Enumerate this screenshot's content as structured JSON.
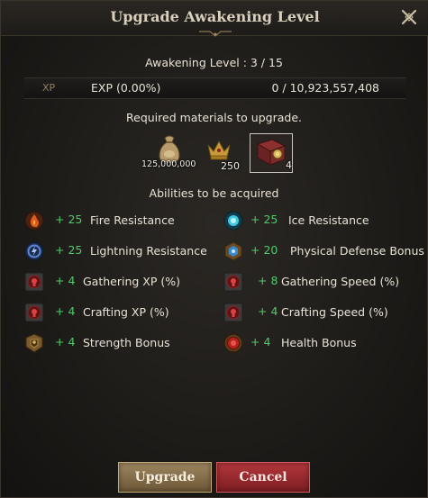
{
  "dialog": {
    "title": "Upgrade Awakening Level",
    "awakening_level_text": "Awakening Level : 3 / 15"
  },
  "xp": {
    "tag": "XP",
    "exp_text": "EXP (0.00%)",
    "value_text": "0 / 10,923,557,408"
  },
  "materials": {
    "label": "Required materials to upgrade.",
    "items": [
      {
        "icon": "silver-bag-icon",
        "quantity": "125,000,000"
      },
      {
        "icon": "crown-icon",
        "quantity": "250"
      },
      {
        "icon": "awakening-book-icon",
        "quantity": "4"
      }
    ]
  },
  "abilities": {
    "label": "Abilities to be acquired",
    "items": [
      {
        "icon": "fire-resistance-icon",
        "value": "+ 25",
        "name": "Fire Resistance"
      },
      {
        "icon": "ice-resistance-icon",
        "value": "+ 25",
        "name": "Ice Resistance"
      },
      {
        "icon": "lightning-resistance-icon",
        "value": "+ 25",
        "name": "Lightning Resistance"
      },
      {
        "icon": "physical-defense-icon",
        "value": "+ 20",
        "name": "Physical Defense Bonus"
      },
      {
        "icon": "gathering-xp-icon",
        "value": "+ 4",
        "name": "Gathering XP (%)"
      },
      {
        "icon": "gathering-speed-icon",
        "value": "+ 8",
        "name": "Gathering Speed (%)"
      },
      {
        "icon": "crafting-xp-icon",
        "value": "+ 4",
        "name": "Crafting XP (%)"
      },
      {
        "icon": "crafting-speed-icon",
        "value": "+ 4",
        "name": "Crafting Speed (%)"
      },
      {
        "icon": "strength-bonus-icon",
        "value": "+ 4",
        "name": "Strength Bonus"
      },
      {
        "icon": "health-bonus-icon",
        "value": "+ 4",
        "name": "Health Bonus"
      }
    ]
  },
  "buttons": {
    "upgrade": "Upgrade",
    "cancel": "Cancel"
  },
  "colors": {
    "ability_value": "#4fc96a",
    "upgrade_button": "#8a734e",
    "cancel_button": "#9c2a30"
  }
}
